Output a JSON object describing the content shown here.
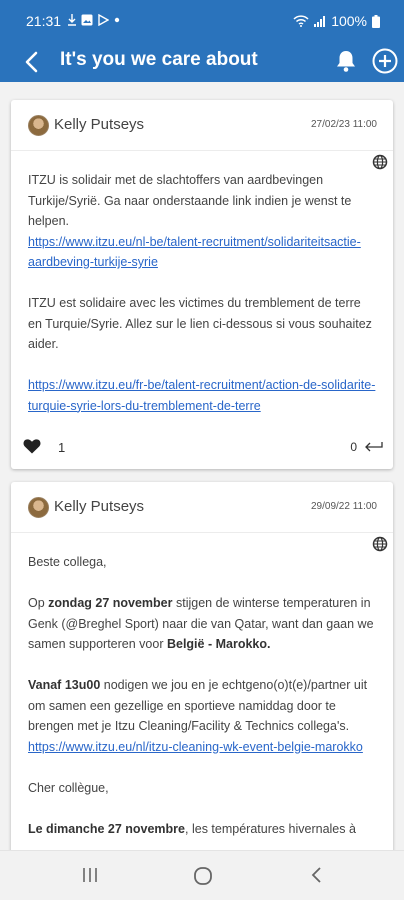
{
  "status": {
    "time": "21:31",
    "battery": "100%"
  },
  "appbar": {
    "title": "It's you we care about",
    "icons": [
      "back-arrow-icon",
      "bell-icon",
      "plus-circle-icon"
    ]
  },
  "posts": [
    {
      "author": "Kelly Putseys",
      "date": "27/02/23 11:00",
      "p1": "ITZU is solidair met de slachtoffers van aardbevingen Turkije/Syrië. Ga naar onderstaande link indien je wenst te helpen.",
      "link1": "https://www.itzu.eu/nl-be/talent-recruitment/solidariteitsactie-aardbeving-turkije-syrie",
      "p2": "ITZU est solidaire avec les victimes du tremblement de terre en Turquie/Syrie. Allez sur le lien ci-dessous si vous souhaitez aider.",
      "link2": "https://www.itzu.eu/fr-be/talent-recruitment/action-de-solidarite-turquie-syrie-lors-du-tremblement-de-terre",
      "likes": "1",
      "comments": "0"
    },
    {
      "author": "Kelly Putseys",
      "date": "29/09/22 11:00",
      "greeting": "Beste collega,",
      "p1_a": "Op ",
      "p1_b": "zondag 27 november",
      "p1_c": " stijgen de winterse temperaturen in Genk (@Breghel Sport) naar die van Qatar, want dan gaan we samen supporteren voor ",
      "p1_d": "België - Marokko.",
      "p2_a": "Vanaf 13u00",
      "p2_b": " nodigen we jou en je echtgeno(o)t(e)/partner uit om samen een gezellige en sportieve namiddag door te brengen met je Itzu Cleaning/Facility & Technics collega's.",
      "link": "https://www.itzu.eu/nl/itzu-cleaning-wk-event-belgie-marokko",
      "greeting_fr": "Cher collègue,",
      "p3_a": "Le dimanche 27 novembre",
      "p3_b": ", les températures hivernales à"
    }
  ]
}
